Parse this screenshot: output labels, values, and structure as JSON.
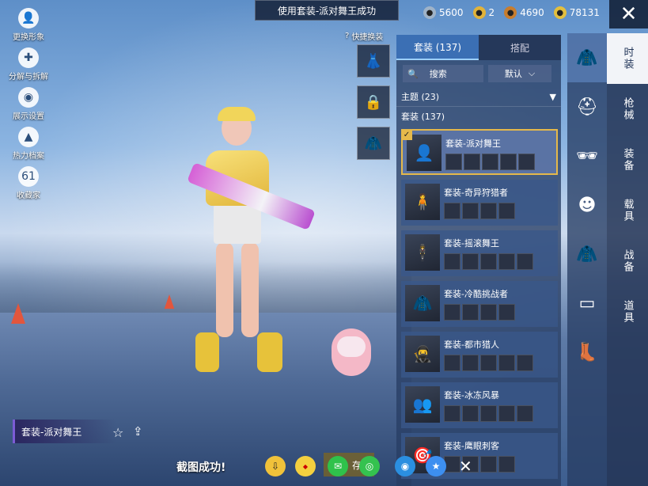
{
  "notification": "使用套装-派对舞王成功",
  "currency": [
    {
      "icon": "gem-icon",
      "value": "5600",
      "color": "#9fb3c8"
    },
    {
      "icon": "medal-icon",
      "value": "2",
      "color": "#e1b33a"
    },
    {
      "icon": "coin-icon",
      "value": "4690",
      "color": "#c77d2e"
    },
    {
      "icon": "bolt-icon",
      "value": "78131",
      "color": "#e3bf3e"
    }
  ],
  "left_menu": [
    {
      "label": "更换形象",
      "icon": "avatar-icon",
      "glyph": "👤"
    },
    {
      "label": "分解与拆解",
      "icon": "puzzle-icon",
      "glyph": "✚"
    },
    {
      "label": "展示设置",
      "icon": "eye-icon",
      "glyph": "◉"
    },
    {
      "label": "热力档案",
      "icon": "flame-icon",
      "glyph": "▲"
    },
    {
      "label": "收藏家",
      "icon": "collector-badge-icon",
      "glyph": "61"
    }
  ],
  "quick_change": "快捷换装",
  "panel": {
    "tabs": [
      "套装 (137)",
      "搭配"
    ],
    "search_placeholder": "搜索",
    "sort": "默认",
    "section_theme": "主题 (23)",
    "section_outfits": "套装 (137)",
    "cards": [
      {
        "title": "套装-派对舞王",
        "selected": true,
        "pieces": 5
      },
      {
        "title": "套装-奇异狩猎者",
        "selected": false,
        "pieces": 4
      },
      {
        "title": "套装-摇滚舞王",
        "selected": false,
        "pieces": 5
      },
      {
        "title": "套装-冷酷挑战者",
        "selected": false,
        "pieces": 4
      },
      {
        "title": "套装-都市猎人",
        "selected": false,
        "pieces": 5
      },
      {
        "title": "套装-冰冻风暴",
        "selected": false,
        "pieces": 5
      },
      {
        "title": "套装-鹰眼刺客",
        "selected": false,
        "pieces": 4
      }
    ]
  },
  "categories": [
    "时装",
    "枪械",
    "装备",
    "载具",
    "战备",
    "道具"
  ],
  "outfit_name": "套装-派对舞王",
  "share_bar": {
    "text": "截图成功!",
    "save_label": "存相"
  }
}
